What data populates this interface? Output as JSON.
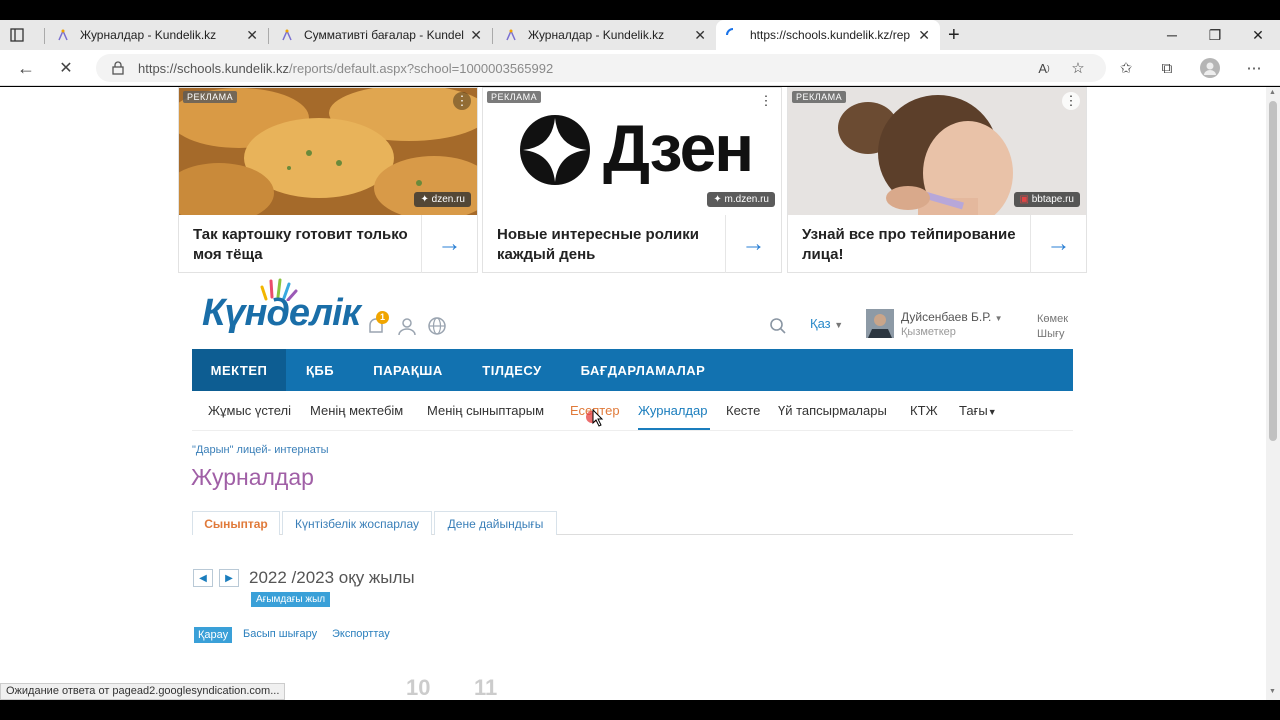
{
  "browser": {
    "tabs": [
      {
        "title": "Журналдар - Kundelik.kz"
      },
      {
        "title": "Суммативті бағалар - Kundelik.kz"
      },
      {
        "title": "Журналдар - Kundelik.kz"
      },
      {
        "title": "https://schools.kundelik.kz/reports"
      }
    ],
    "new_tab": "+",
    "url_host": "https://schools.kundelik.kz",
    "url_path": "/reports/default.aspx?school=1000003565992"
  },
  "ads": [
    {
      "tag": "РЕКЛАМА",
      "source": "dzen.ru",
      "text": "Так картошку готовит только моя тёща"
    },
    {
      "tag": "РЕКЛАМА",
      "source": "m.dzen.ru",
      "text": "Новые интересные ролики каждый день",
      "brand": "Дзен"
    },
    {
      "tag": "РЕКЛАМА",
      "source": "bbtape.ru",
      "text": "Узнай все про тейпирование лица!"
    }
  ],
  "header": {
    "logo": "Күнделік",
    "notif_count": "1",
    "lang": "Қаз",
    "user_name": "Дуйсенбаев Б.Р.",
    "user_role": "Қызметкер",
    "help": "Көмек",
    "logout": "Шығу"
  },
  "main_nav": [
    "МЕКТЕП",
    "ҚББ",
    "ПАРАҚША",
    "ТІЛДЕСУ",
    "БАҒДАРЛАМАЛАР"
  ],
  "sub_nav": [
    "Жұмыс үстелі",
    "Менің мектебім",
    "Менің сыныптарым",
    "Есептер",
    "Журналдар",
    "Кесте",
    "Үй тапсырмалары",
    "КТЖ",
    "Тағы"
  ],
  "breadcrumb": "\"Дарын\" лицей- интернаты",
  "page_title": "Журналдар",
  "sub_tabs": [
    "Сыныптар",
    "Күнтізбелік жоспарлау",
    "Дене дайындығы"
  ],
  "year": {
    "label": "2022 /2023 оқу жылы",
    "current": "Ағымдағы жыл"
  },
  "actions": [
    "Қарау",
    "Басып шығару",
    "Экспорттау"
  ],
  "grades": [
    "10",
    "11"
  ],
  "status": "Ожидание ответа от pagead2.googlesyndication.com..."
}
